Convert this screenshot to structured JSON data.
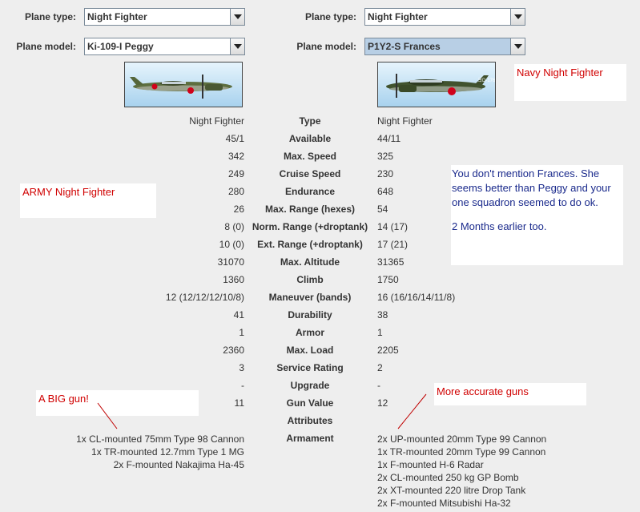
{
  "left": {
    "plane_type_label": "Plane type:",
    "plane_type": "Night Fighter",
    "plane_model_label": "Plane model:",
    "plane_model": "Ki-109-I Peggy"
  },
  "right": {
    "plane_type_label": "Plane type:",
    "plane_type": "Night Fighter",
    "plane_model_label": "Plane model:",
    "plane_model": "P1Y2-S Frances"
  },
  "stats": [
    {
      "label": "Type",
      "left": "Night Fighter",
      "right": "Night Fighter"
    },
    {
      "label": "Available",
      "left": "45/1",
      "right": "44/11"
    },
    {
      "label": "Max. Speed",
      "left": "342",
      "right": "325"
    },
    {
      "label": "Cruise Speed",
      "left": "249",
      "right": "230"
    },
    {
      "label": "Endurance",
      "left": "280",
      "right": "648"
    },
    {
      "label": "Max. Range (hexes)",
      "left": "26",
      "right": "54"
    },
    {
      "label": "Norm. Range (+droptank)",
      "left": "8 (0)",
      "right": "14 (17)"
    },
    {
      "label": "Ext. Range (+droptank)",
      "left": "10 (0)",
      "right": "17 (21)"
    },
    {
      "label": "Max. Altitude",
      "left": "31070",
      "right": "31365"
    },
    {
      "label": "Climb",
      "left": "1360",
      "right": "1750"
    },
    {
      "label": "Maneuver (bands)",
      "left": "12 (12/12/12/10/8)",
      "right": "16 (16/16/14/11/8)"
    },
    {
      "label": "Durability",
      "left": "41",
      "right": "38"
    },
    {
      "label": "Armor",
      "left": "1",
      "right": "1"
    },
    {
      "label": "Max. Load",
      "left": "2360",
      "right": "2205"
    },
    {
      "label": "Service Rating",
      "left": "3",
      "right": "2"
    },
    {
      "label": "Upgrade",
      "left": "-",
      "right": "-"
    },
    {
      "label": "Gun Value",
      "left": "11",
      "right": "12"
    },
    {
      "label": "Attributes",
      "left": "",
      "right": ""
    }
  ],
  "armament": {
    "label": "Armament",
    "left": [
      "1x CL-mounted 75mm Type 98 Cannon",
      "1x TR-mounted 12.7mm Type 1 MG",
      "2x F-mounted Nakajima Ha-45"
    ],
    "right": [
      "2x UP-mounted 20mm Type 99 Cannon",
      "1x TR-mounted 20mm Type 99 Cannon",
      "1x F-mounted H-6 Radar",
      "2x CL-mounted 250 kg GP Bomb",
      "2x XT-mounted 220 litre Drop Tank",
      "2x F-mounted Mitsubishi Ha-32"
    ]
  },
  "notes": {
    "navy": "Navy Night Fighter",
    "army": "ARMY Night Fighter",
    "frances_1": "You don't mention Frances.  She seems better than Peggy and your one squadron seemed to do ok.",
    "frances_2": "2 Months earlier too.",
    "big_gun": "A BIG gun!",
    "accurate": "More accurate guns"
  },
  "colors": {
    "background": "#eeeeee",
    "note_red": "#d00000",
    "note_blue": "#1a2a8c",
    "selected_combo": "#b8cfe5"
  }
}
